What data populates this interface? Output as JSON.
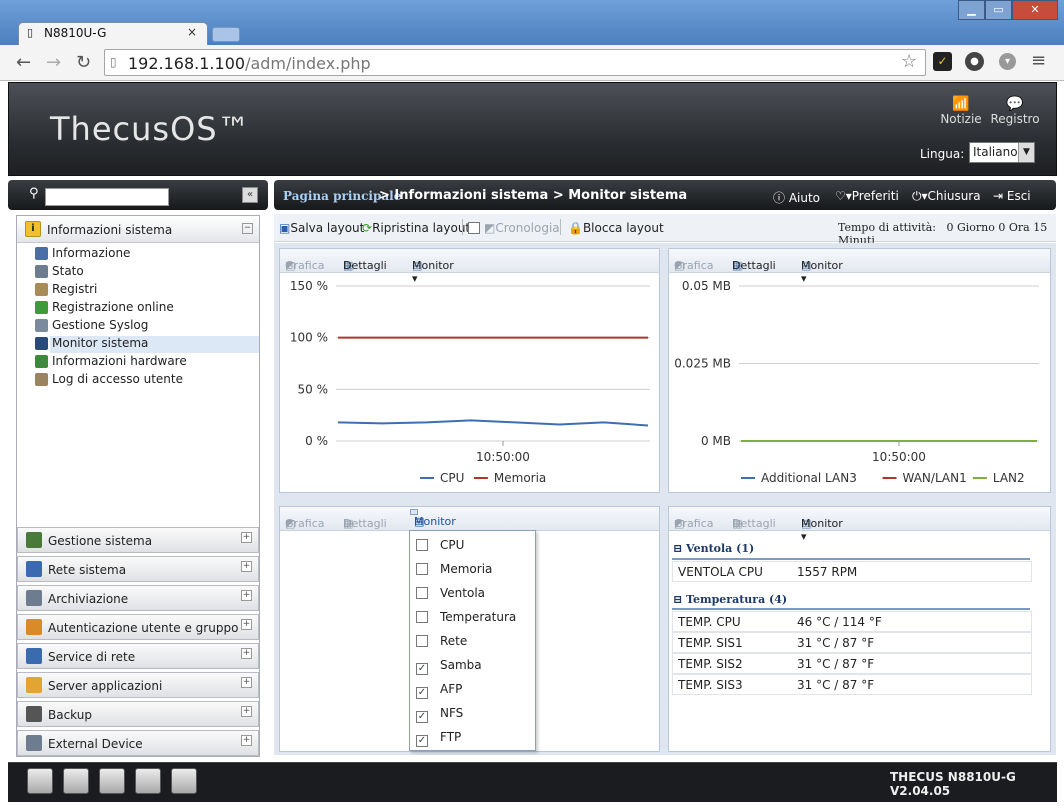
{
  "browser": {
    "tab_title": "N8810U-G",
    "tab_close": "×",
    "url_host": "192.168.1.100",
    "url_path": "/adm/index.php",
    "win_min": "▁",
    "win_max": "▭",
    "win_close": "✕"
  },
  "header": {
    "brand": "ThecusOS™",
    "notifications": "Notizie",
    "log": "Registro",
    "language_label": "Lingua:",
    "language_value": "Italiano"
  },
  "breadcrumb": {
    "home": "Pagina principale",
    "rest": "> Informazioni sistema > Monitor sistema"
  },
  "topbar": {
    "help": "Aiuto",
    "favorites": "Preferiti",
    "shutdown": "Chiusura",
    "logout": "Esci"
  },
  "sidebar": {
    "open_section": "Informazioni sistema",
    "items": [
      "Informazione",
      "Stato",
      "Registri",
      "Registrazione online",
      "Gestione Syslog",
      "Monitor sistema",
      "Informazioni hardware",
      "Log di accesso utente"
    ],
    "categories": [
      "Gestione sistema",
      "Rete sistema",
      "Archiviazione",
      "Autenticazione utente e gruppo",
      "Service di rete",
      "Server applicazioni",
      "Backup",
      "External Device"
    ]
  },
  "toolbar": {
    "save_layout": "Salva layout",
    "restore_layout": "Ripristina layout",
    "history": "Cronologia",
    "lock_layout": "Blocca layout",
    "uptime_label": "Tempo di attività:",
    "uptime_value": "0 Giorno 0 Ora 15 Minuti"
  },
  "panel_tools": {
    "graph": "Grafica",
    "details": "Dettagli",
    "monitor": "Monitor ▾"
  },
  "chart_data": [
    {
      "type": "line",
      "x": [
        "10:50:00"
      ],
      "y_ticks": [
        "150 %",
        "100 %",
        "50 %",
        "0 %"
      ],
      "ylim": [
        0,
        150
      ],
      "series": [
        {
          "name": "CPU",
          "color": "#3d6eb4",
          "values": [
            18,
            17,
            18,
            20,
            18,
            16,
            18,
            15
          ]
        },
        {
          "name": "Memoria",
          "color": "#b8322a",
          "values": [
            100,
            100,
            100,
            100,
            100,
            100,
            100,
            100
          ]
        }
      ]
    },
    {
      "type": "line",
      "x": [
        "10:50:00"
      ],
      "y_ticks": [
        "0.05 MB",
        "0.025 MB",
        "0 MB"
      ],
      "ylim": [
        0,
        0.05
      ],
      "series": [
        {
          "name": "Additional LAN3",
          "color": "#3d6eb4",
          "values": [
            0,
            0,
            0,
            0,
            0
          ]
        },
        {
          "name": "WAN/LAN1",
          "color": "#b8322a",
          "values": [
            0,
            0,
            0,
            0,
            0
          ]
        },
        {
          "name": "LAN2",
          "color": "#7fae3c",
          "values": [
            0,
            0,
            0,
            0,
            0
          ]
        }
      ]
    }
  ],
  "monitor_menu": [
    {
      "label": "CPU",
      "checked": false
    },
    {
      "label": "Memoria",
      "checked": false
    },
    {
      "label": "Ventola",
      "checked": false
    },
    {
      "label": "Temperatura",
      "checked": false
    },
    {
      "label": "Rete",
      "checked": false
    },
    {
      "label": "Samba",
      "checked": true
    },
    {
      "label": "AFP",
      "checked": true
    },
    {
      "label": "NFS",
      "checked": true
    },
    {
      "label": "FTP",
      "checked": true
    }
  ],
  "fan_group": {
    "title": "Ventola (1)",
    "rows": [
      {
        "name": "VENTOLA CPU",
        "value": "1557 RPM"
      }
    ]
  },
  "temp_group": {
    "title": "Temperatura (4)",
    "rows": [
      {
        "name": "TEMP. CPU",
        "value": "46 °C / 114 °F"
      },
      {
        "name": "TEMP. SIS1",
        "value": "31 °C / 87 °F"
      },
      {
        "name": "TEMP. SIS2",
        "value": "31 °C / 87 °F"
      },
      {
        "name": "TEMP. SIS3",
        "value": "31 °C / 87 °F"
      }
    ]
  },
  "footer": {
    "version": "THECUS N8810U-G V2.04.05"
  },
  "colors": {
    "accent": "#3d6eb4",
    "memory": "#b8322a",
    "lan2": "#7fae3c",
    "header": "#2c2f33"
  }
}
